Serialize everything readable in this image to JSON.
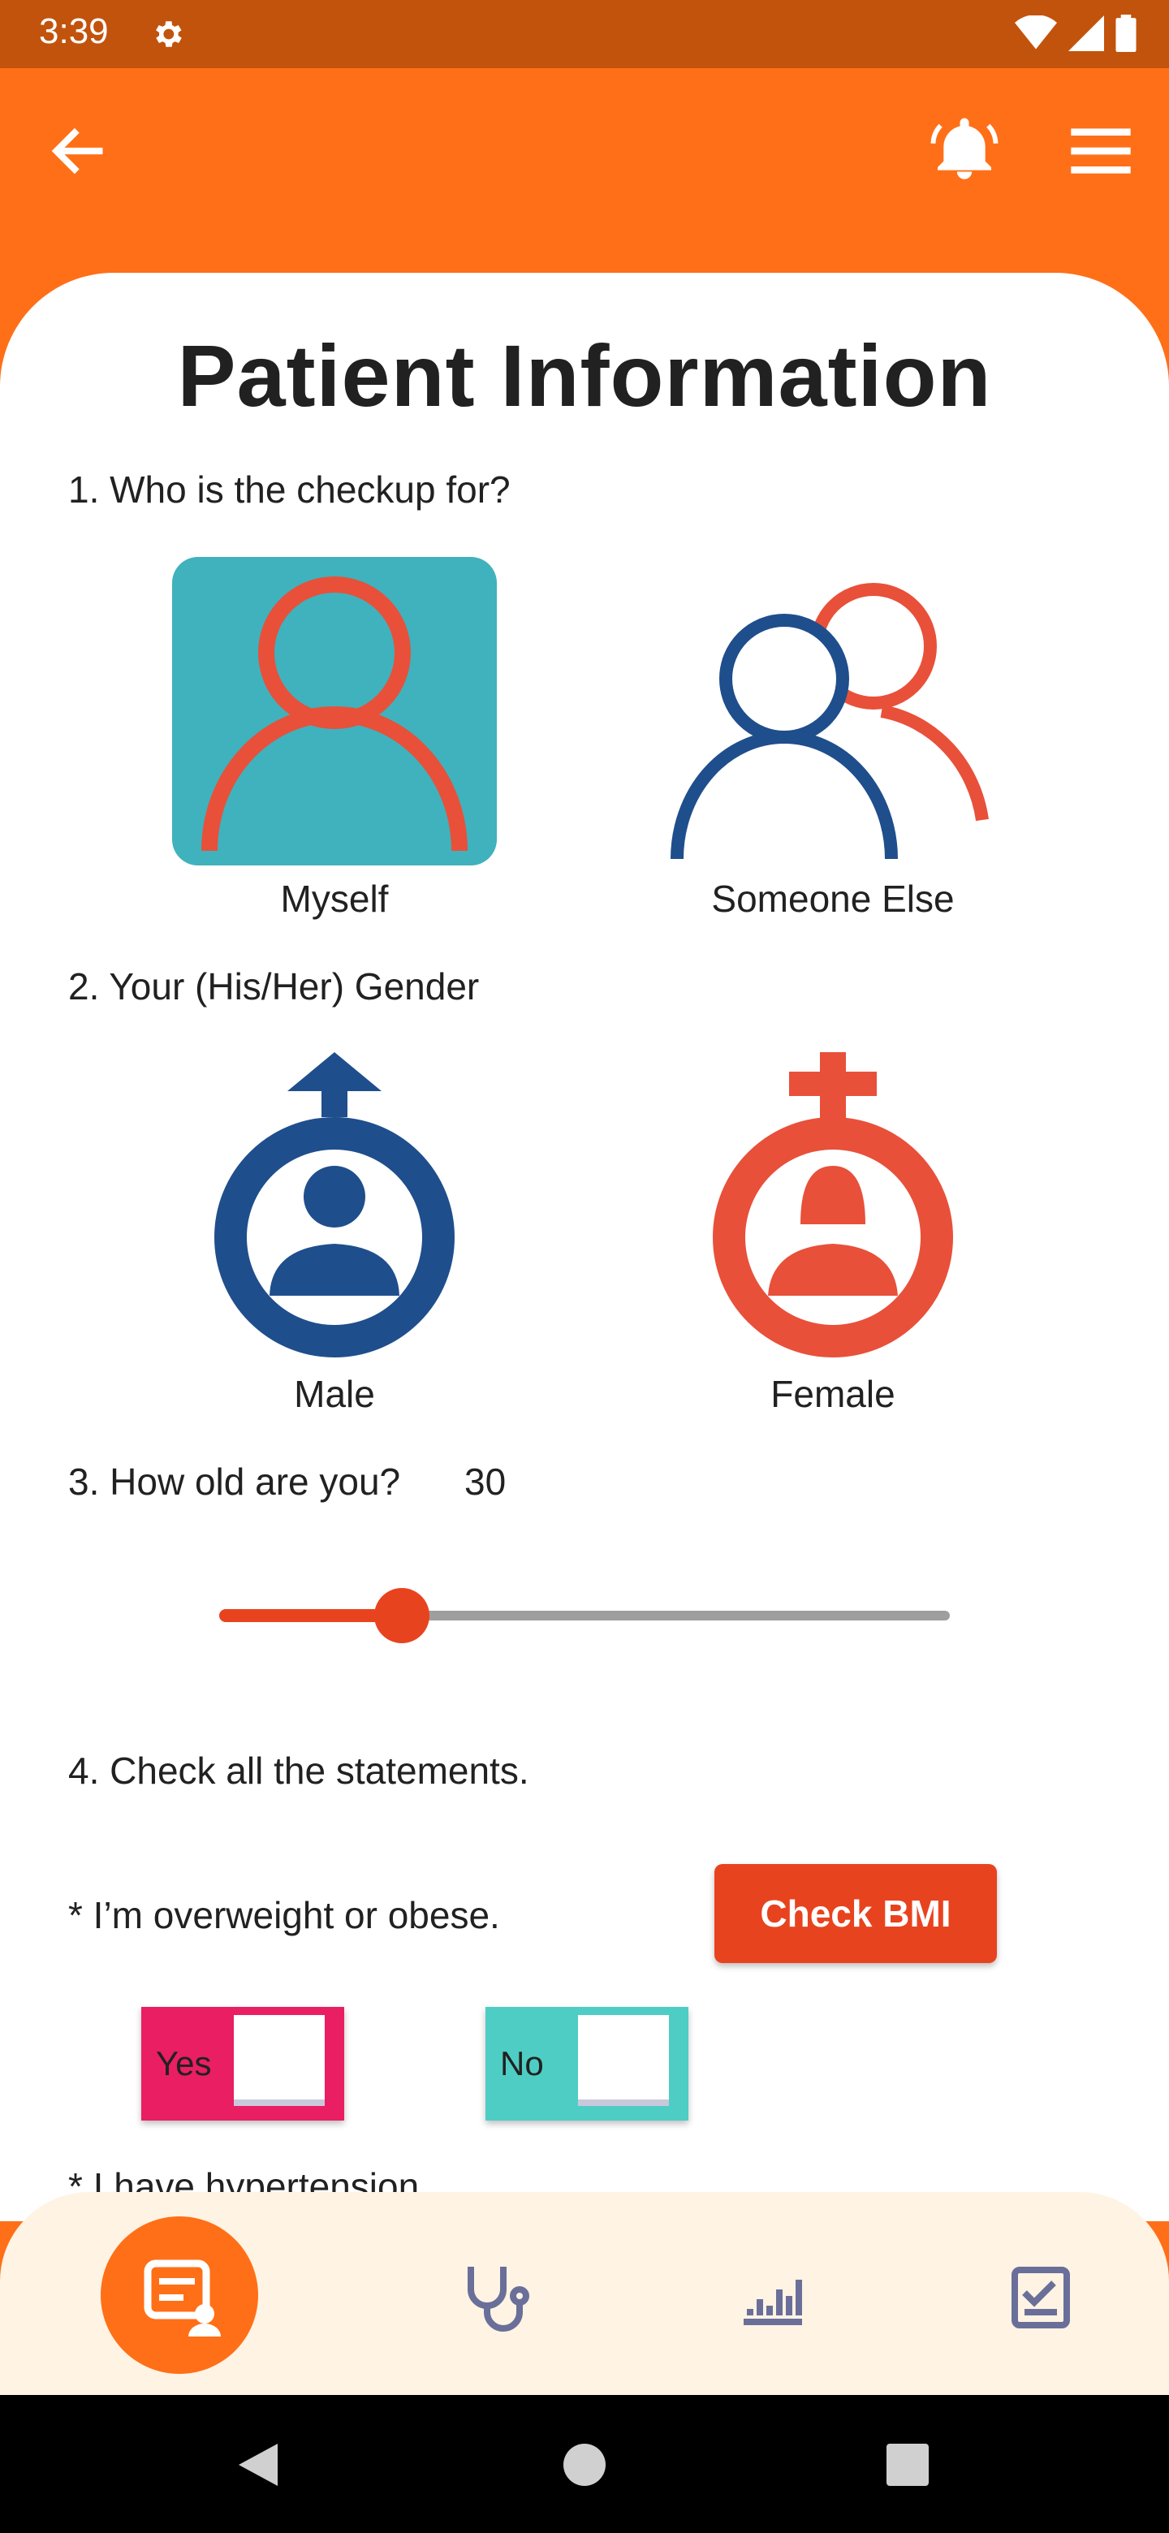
{
  "status_bar": {
    "time": "3:39"
  },
  "header": {
    "back_icon": "arrow-left-icon",
    "bell_icon": "bell-ringing-icon",
    "menu_icon": "hamburger-menu-icon"
  },
  "page": {
    "title": "Patient Information"
  },
  "q1": {
    "text": "1. Who is the checkup for?",
    "options": [
      {
        "label": "Myself",
        "selected": true
      },
      {
        "label": "Someone Else",
        "selected": false
      }
    ]
  },
  "q2": {
    "text": "2. Your (His/Her) Gender",
    "options": [
      {
        "label": "Male"
      },
      {
        "label": "Female"
      }
    ]
  },
  "q3": {
    "text": "3. How old are you?",
    "value": "30",
    "slider_fraction": 0.25
  },
  "q4": {
    "text": "4. Check all the statements.",
    "statement1": "* I’m overweight or obese.",
    "bmi_button": "Check BMI",
    "yes_label": "Yes",
    "no_label": "No",
    "statement2": "* I have hypertension."
  },
  "colors": {
    "primary": "#ff6f17",
    "accent": "#e8431f",
    "teal": "#3fb2bd",
    "blue": "#1f4e8c",
    "yes_toggle": "#e91e63",
    "no_toggle": "#4ecdc4"
  },
  "bottom_nav": [
    "chat-doctor-icon",
    "stethoscope-icon",
    "chart-icon",
    "checklist-icon"
  ]
}
